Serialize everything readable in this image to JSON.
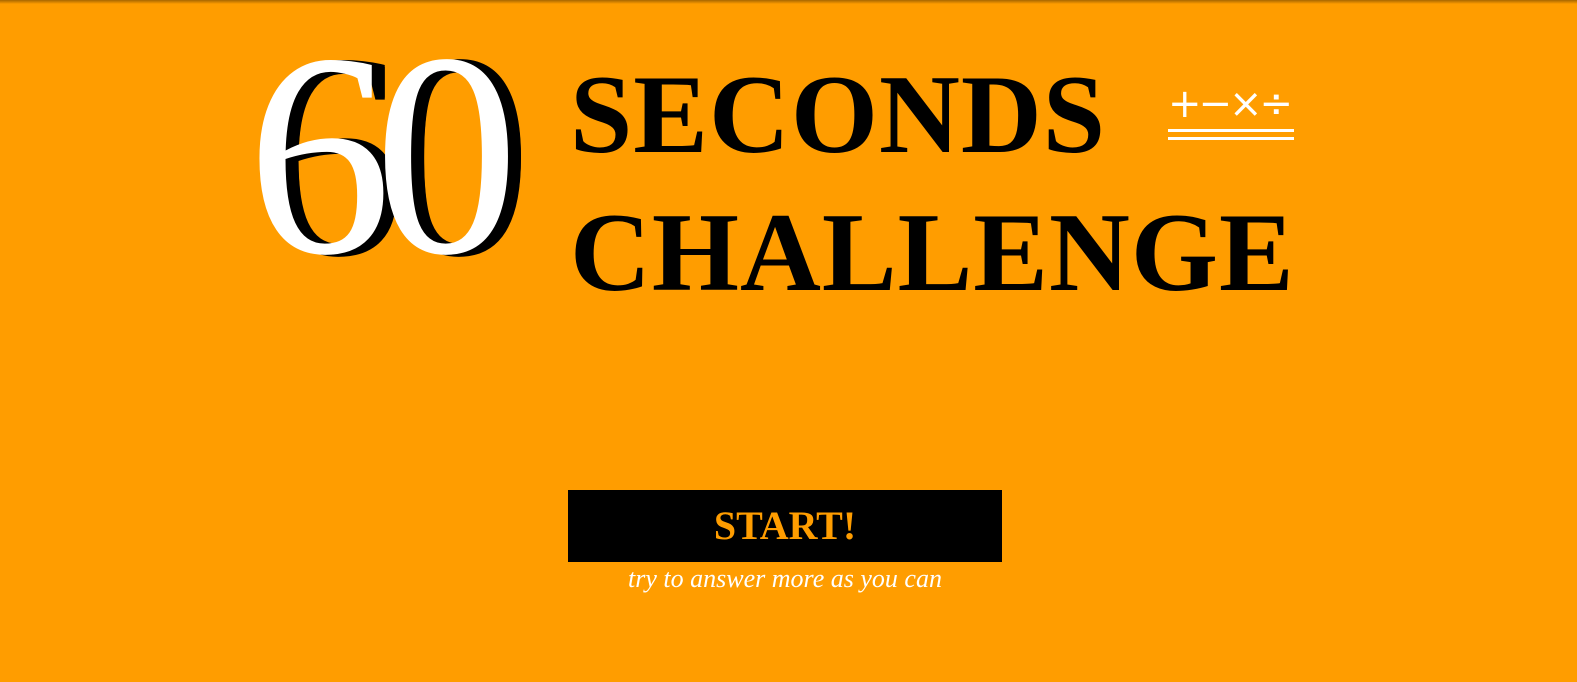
{
  "logo": {
    "number": "60",
    "title_line1": "SECONDS",
    "title_line2": "CHALLENGE",
    "operators": "+−×÷"
  },
  "start": {
    "label": "START!"
  },
  "hint": "try to answer more as you can",
  "colors": {
    "background": "#ff9d00",
    "title": "#000000",
    "number": "#ffffff",
    "button_background": "#000000",
    "button_text": "#ff9d00",
    "hint_text": "#ffffff"
  },
  "icons": {
    "operators": "math-operators-icon"
  }
}
